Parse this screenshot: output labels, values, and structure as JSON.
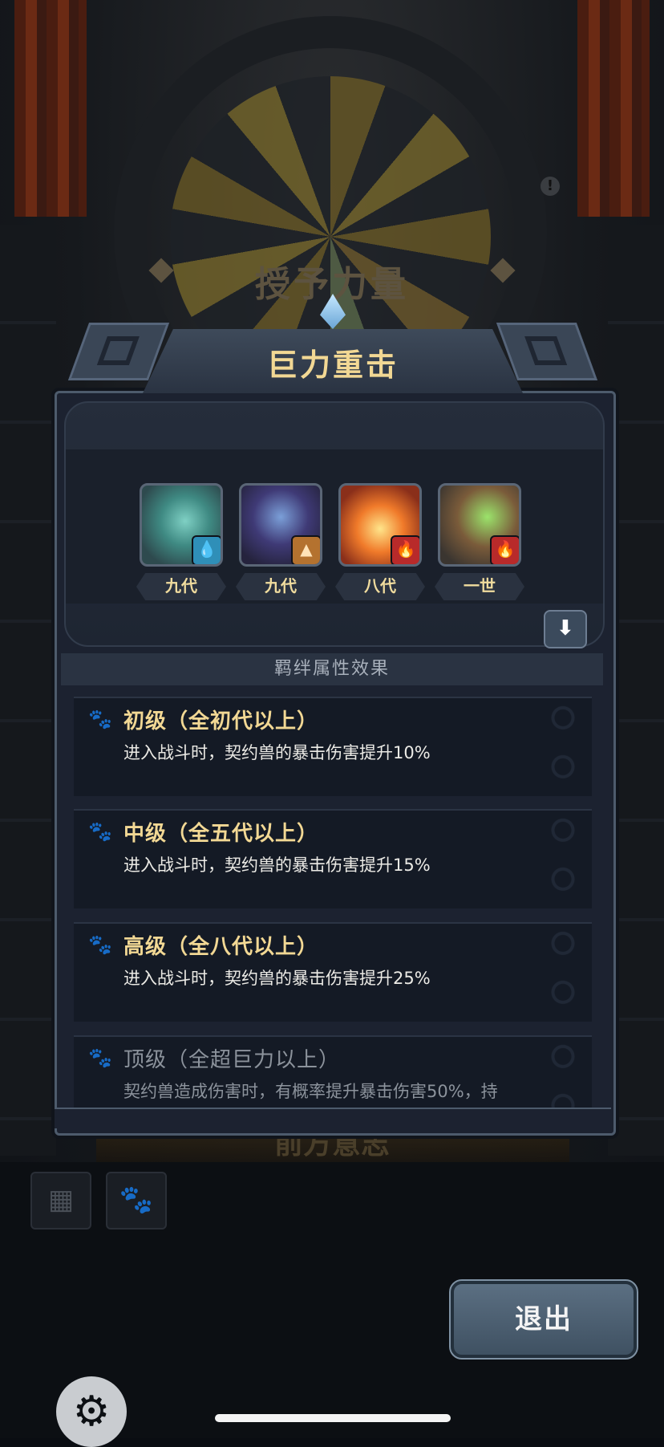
{
  "background": {
    "title": "授予力量",
    "subtitle": "前方意志",
    "hint_icon": "exclamation-icon"
  },
  "panel": {
    "title": "巨力重击",
    "members": [
      {
        "generation": "九代",
        "element_icon": "water-drop-icon"
      },
      {
        "generation": "九代",
        "element_icon": "earth-icon"
      },
      {
        "generation": "八代",
        "element_icon": "fire-icon"
      },
      {
        "generation": "一世",
        "element_icon": "fire-icon"
      }
    ],
    "expand_icon": "arrow-down-icon",
    "section_title": "羁绊属性效果",
    "tiers": [
      {
        "title": "初级（全初代以上）",
        "description": "进入战斗时，契约兽的暴击伤害提升10%",
        "unlocked": true
      },
      {
        "title": "中级（全五代以上）",
        "description": "进入战斗时，契约兽的暴击伤害提升15%",
        "unlocked": true
      },
      {
        "title": "高级（全八代以上）",
        "description": "进入战斗时，契约兽的暴击伤害提升25%",
        "unlocked": true
      },
      {
        "title": "顶级（全超巨力以上）",
        "description": "契约兽造成伤害时，有概率提升暴击伤害50%，持",
        "unlocked": false
      }
    ]
  },
  "toolbar": {
    "blocks_icon": "blocks-icon",
    "paw_icon": "paw-icon",
    "exit_label": "退出",
    "settings_icon": "gear-wrench-icon"
  },
  "colors": {
    "accent_gold": "#f2d894",
    "panel_bg": "#1c2230",
    "locked_text": "#8c939c"
  }
}
